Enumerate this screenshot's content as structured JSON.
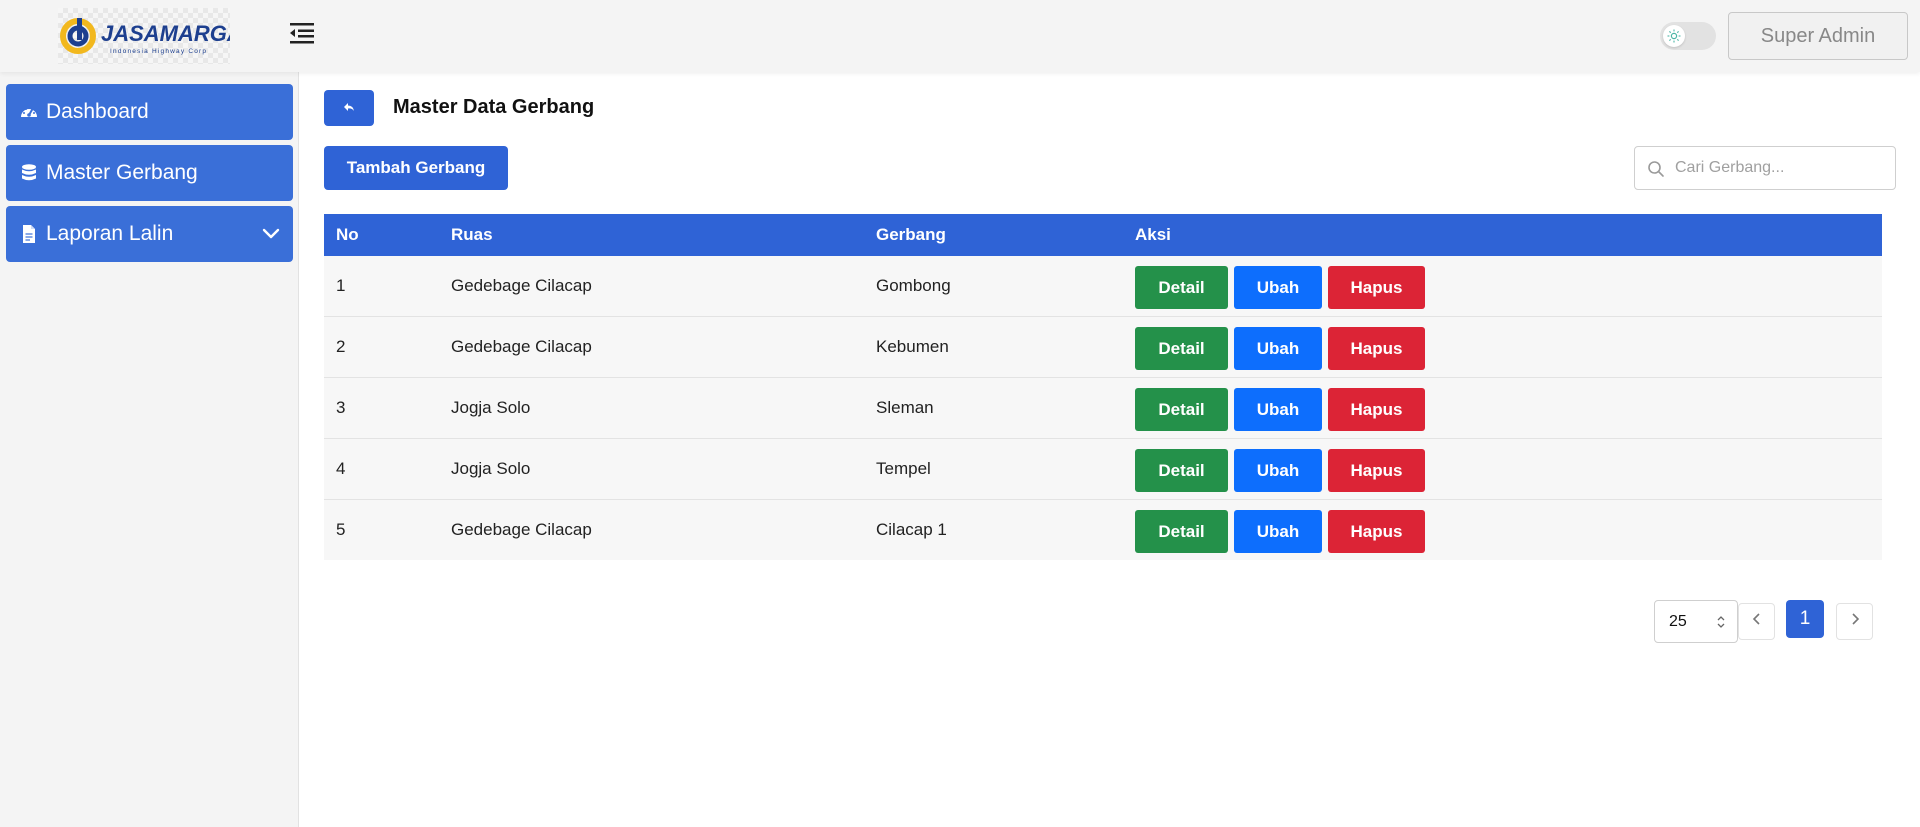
{
  "brand": {
    "logo_text": "JASAMARGA",
    "logo_tagline": "Indonesia Highway Corp",
    "colors": {
      "navy": "#1d3f8f",
      "yellow": "#f2b81e"
    }
  },
  "header": {
    "user_label": "Super Admin",
    "theme_toggle_icon": "sun-icon",
    "menu_toggle_icon": "menu-indent-icon"
  },
  "sidebar": {
    "items": [
      {
        "label": "Dashboard",
        "icon": "gauge-icon"
      },
      {
        "label": "Master Gerbang",
        "icon": "database-icon"
      },
      {
        "label": "Laporan Lalin",
        "icon": "file-icon",
        "expand_icon": "chevron-down-icon"
      }
    ]
  },
  "main": {
    "back_icon": "back-arrow-icon",
    "title": "Master Data Gerbang",
    "add_label": "Tambah Gerbang",
    "search_placeholder": "Cari Gerbang..."
  },
  "table": {
    "columns": [
      "No",
      "Ruas",
      "Gerbang",
      "Aksi"
    ],
    "rows": [
      {
        "no": "1",
        "ruas": "Gedebage Cilacap",
        "gerbang": "Gombong"
      },
      {
        "no": "2",
        "ruas": "Gedebage Cilacap",
        "gerbang": "Kebumen"
      },
      {
        "no": "3",
        "ruas": "Jogja Solo",
        "gerbang": "Sleman"
      },
      {
        "no": "4",
        "ruas": "Jogja Solo",
        "gerbang": "Tempel"
      },
      {
        "no": "5",
        "ruas": "Gedebage Cilacap",
        "gerbang": "Cilacap 1"
      }
    ],
    "actions": {
      "detail": "Detail",
      "edit": "Ubah",
      "delete": "Hapus"
    },
    "action_colors": {
      "detail": "#24914a",
      "edit": "#0d6efd",
      "delete": "#dc2436"
    }
  },
  "pagination": {
    "per_page": "25",
    "current_page": "1"
  },
  "colors": {
    "primary": "#2f63d6",
    "sidebar_item": "#3a6fd8",
    "page_bg": "#f4f4f4"
  }
}
